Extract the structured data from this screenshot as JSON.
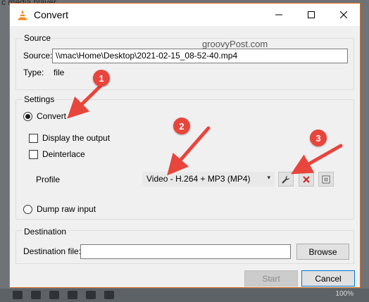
{
  "background": {
    "caption": "c media player",
    "volume_pct": "100%"
  },
  "window": {
    "title": "Convert",
    "icon": "vlc-cone-icon",
    "accent_border": "#d96c1f"
  },
  "watermark": "groovyPost.com",
  "source": {
    "group_label": "Source",
    "source_label": "Source:",
    "source_value": "\\\\mac\\Home\\Desktop\\2021-02-15_08-52-40.mp4",
    "type_label": "Type:",
    "type_value": "file"
  },
  "settings": {
    "group_label": "Settings",
    "convert_label": "Convert",
    "display_output_label": "Display the output",
    "deinterlace_label": "Deinterlace",
    "profile_label": "Profile",
    "profile_value": "Video - H.264 + MP3 (MP4)",
    "dump_raw_label": "Dump raw input"
  },
  "destination": {
    "group_label": "Destination",
    "file_label": "Destination file:",
    "file_value": "",
    "browse_label": "Browse"
  },
  "footer": {
    "start_label": "Start",
    "cancel_label": "Cancel"
  },
  "annotations": {
    "badges": [
      "1",
      "2",
      "3"
    ],
    "color": "#e8453c"
  }
}
